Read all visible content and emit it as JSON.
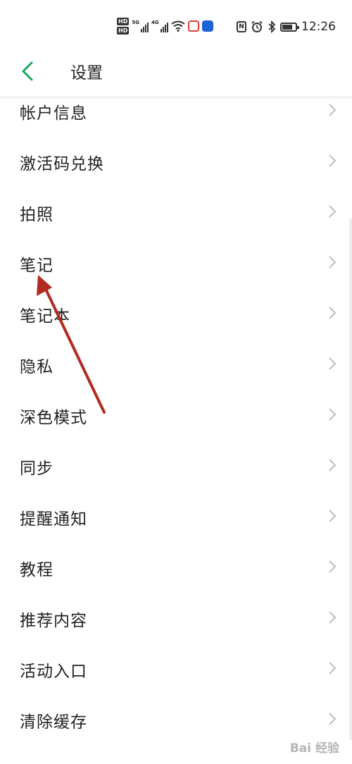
{
  "status": {
    "time": "12:26",
    "hd1": "HD",
    "hd2": "HD",
    "net1": "5G",
    "net2": "4G",
    "nfc": "N"
  },
  "header": {
    "title": "设置"
  },
  "settings": {
    "items": [
      {
        "label": "帐户信息"
      },
      {
        "label": "激活码兑换"
      },
      {
        "label": "拍照"
      },
      {
        "label": "笔记"
      },
      {
        "label": "笔记本"
      },
      {
        "label": "隐私"
      },
      {
        "label": "深色模式"
      },
      {
        "label": "同步"
      },
      {
        "label": "提醒通知"
      },
      {
        "label": "教程"
      },
      {
        "label": "推荐内容"
      },
      {
        "label": "活动入口"
      },
      {
        "label": "清除缓存"
      }
    ]
  },
  "watermark": "Bai 经验",
  "colors": {
    "accent": "#19a65a",
    "annotation_arrow": "#b22a22"
  }
}
